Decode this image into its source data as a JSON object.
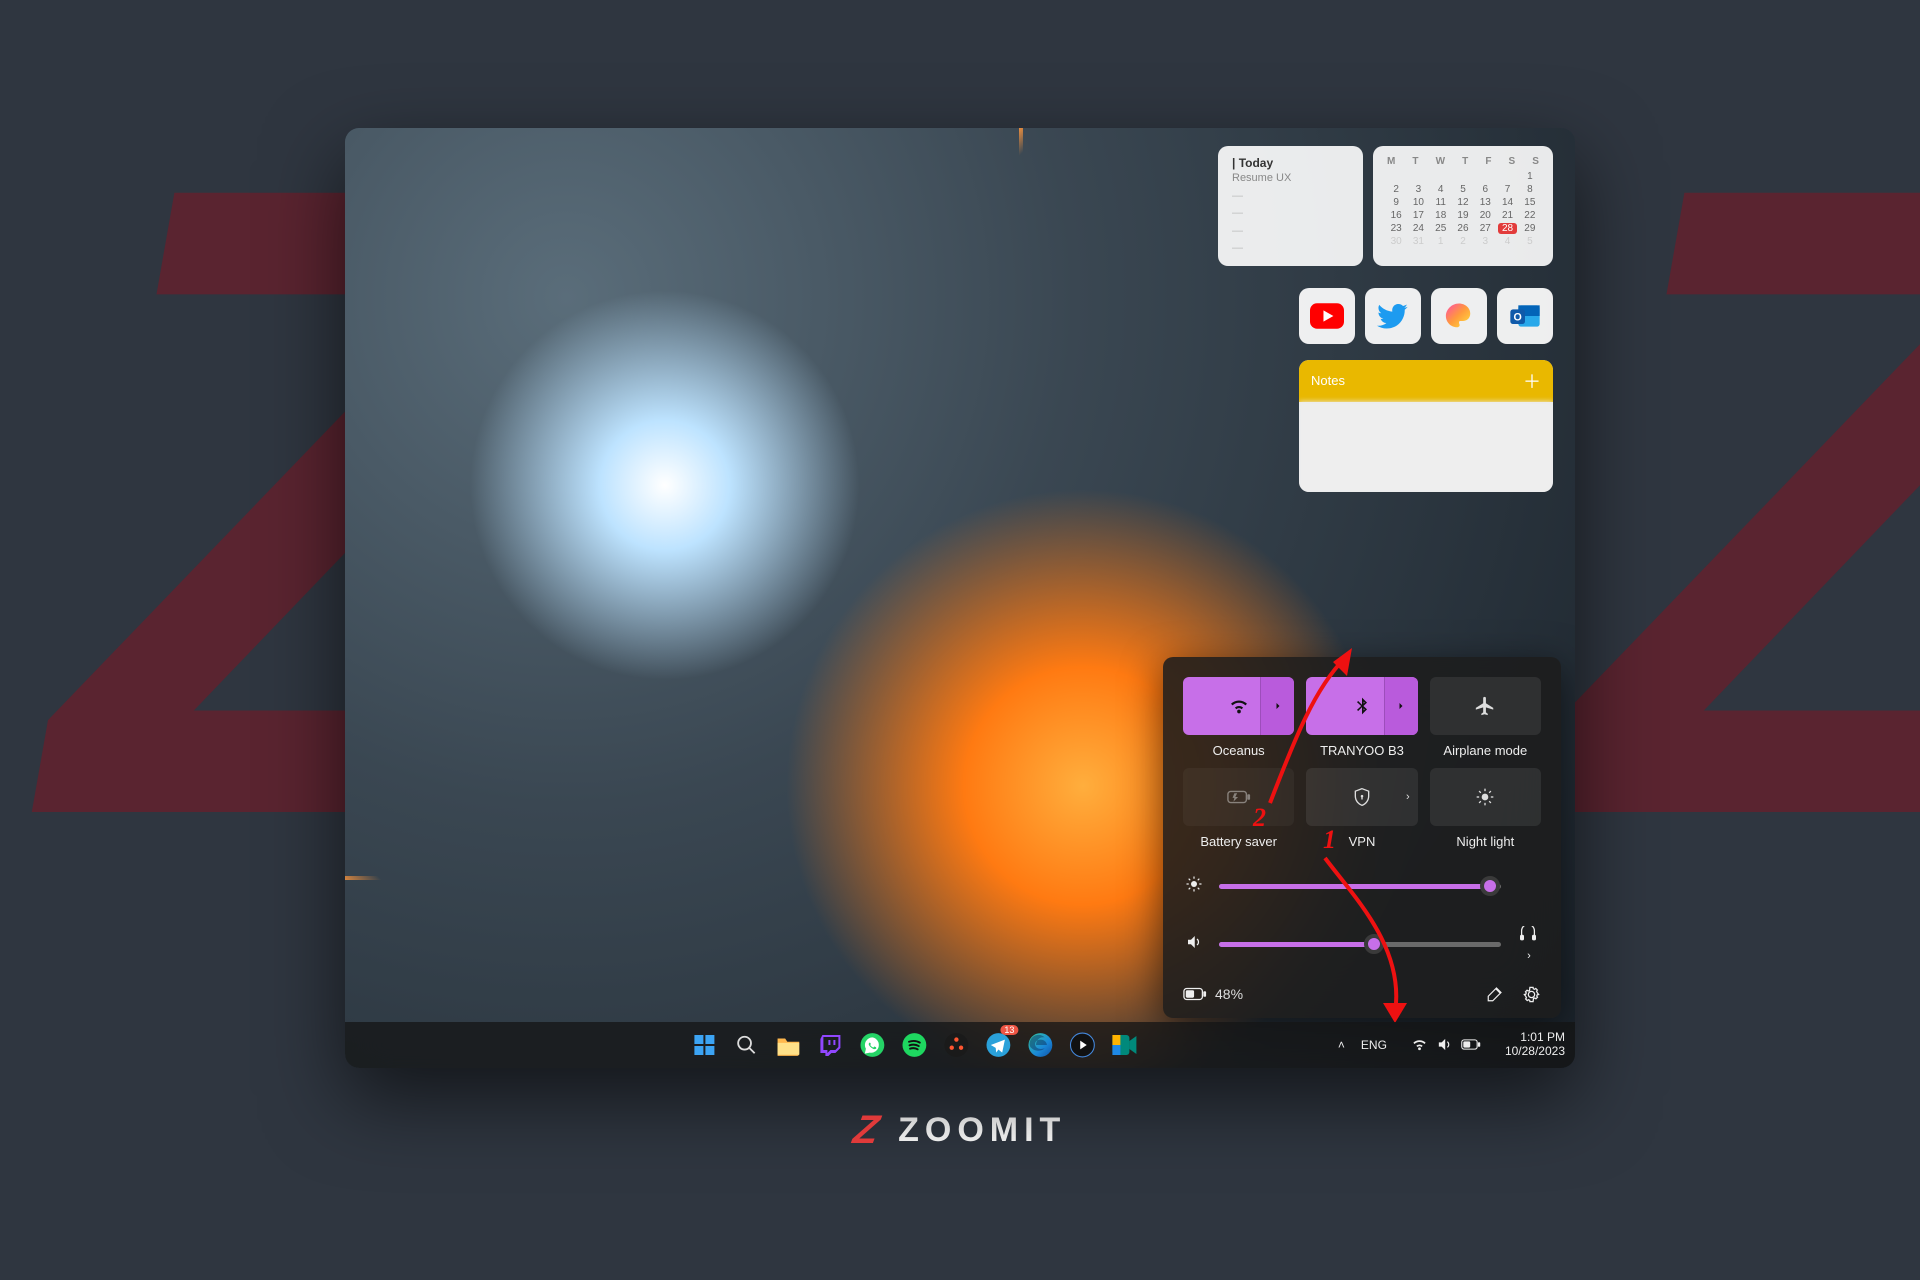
{
  "widgets": {
    "today": {
      "title": "| Today",
      "subtitle": "Resume UX"
    },
    "calendar": {
      "dow": [
        "M",
        "T",
        "W",
        "T",
        "F",
        "S",
        "S"
      ],
      "days": [
        "",
        "",
        "",
        "",
        "",
        "",
        "1",
        "2",
        "3",
        "4",
        "5",
        "6",
        "7",
        "8",
        "9",
        "10",
        "11",
        "12",
        "13",
        "14",
        "15",
        "16",
        "17",
        "18",
        "19",
        "20",
        "21",
        "22",
        "23",
        "24",
        "25",
        "26",
        "27",
        "28",
        "29",
        "30",
        "31",
        "1",
        "2",
        "3",
        "4",
        "5"
      ],
      "highlight": "28"
    },
    "notes": {
      "title": "Notes"
    }
  },
  "app_shortcuts": [
    "youtube",
    "twitter",
    "paint",
    "outlook"
  ],
  "quick_settings": {
    "tiles": [
      {
        "id": "wifi",
        "label": "Oceanus",
        "active": true,
        "expandable": true
      },
      {
        "id": "bluetooth",
        "label": "TRANYOO B3",
        "active": true,
        "expandable": true
      },
      {
        "id": "airplane",
        "label": "Airplane mode",
        "active": false,
        "expandable": false
      },
      {
        "id": "battery-saver",
        "label": "Battery saver",
        "active": false,
        "expandable": false,
        "disabled": true
      },
      {
        "id": "vpn",
        "label": "VPN",
        "active": false,
        "expandable": true
      },
      {
        "id": "night-light",
        "label": "Night light",
        "active": false,
        "expandable": false
      }
    ],
    "brightness_pct": 96,
    "volume_pct": 55,
    "battery_label": "48%"
  },
  "annotations": {
    "label1": "1",
    "label2": "2"
  },
  "taskbar": {
    "apps": [
      "start",
      "search",
      "explorer",
      "twitch",
      "whatsapp",
      "spotify",
      "davinci",
      "telegram",
      "edge",
      "media",
      "meet"
    ],
    "tray": {
      "lang": "ENG",
      "time": "1:01 PM",
      "date": "10/28/2023"
    }
  },
  "brand": "ZOOMIT"
}
